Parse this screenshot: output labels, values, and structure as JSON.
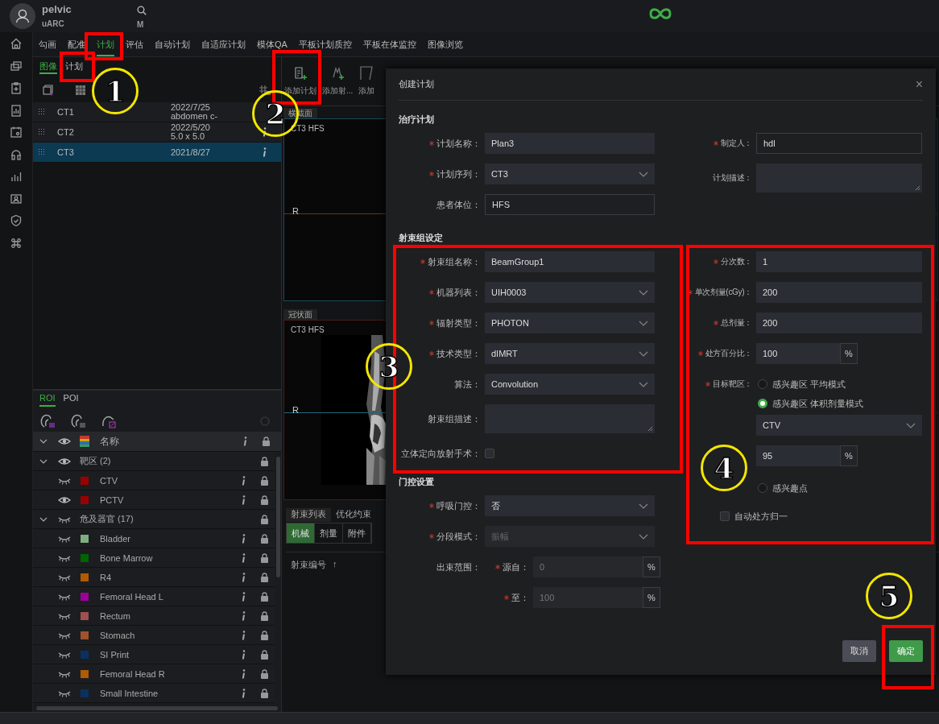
{
  "header": {
    "user": "pelvic",
    "subtitle": "uARC",
    "search_label": "M"
  },
  "nav_tabs": [
    {
      "label": "勾画",
      "selected": false
    },
    {
      "label": "配准",
      "selected": false
    },
    {
      "label": "计划",
      "selected": true
    },
    {
      "label": "评估",
      "selected": false
    },
    {
      "label": "自动计划",
      "selected": false
    },
    {
      "label": "自适应计划",
      "selected": false
    },
    {
      "label": "模体QA",
      "selected": false
    },
    {
      "label": "平板计划质控",
      "selected": false
    },
    {
      "label": "平板在体监控",
      "selected": false
    },
    {
      "label": "图像浏览",
      "selected": false
    }
  ],
  "left_panel": {
    "tabs": [
      {
        "label": "图像",
        "selected": true
      },
      {
        "label": "计划",
        "selected": false
      }
    ],
    "images": [
      {
        "name": "CT1",
        "date": "2022/7/25",
        "detail": "abdomen c-",
        "info": false,
        "selected": false
      },
      {
        "name": "CT2",
        "date": "2022/5/20",
        "detail": "5.0 x 5.0",
        "info": true,
        "selected": false
      },
      {
        "name": "CT3",
        "date": "2021/8/27",
        "info": true,
        "selected": true
      }
    ]
  },
  "roi_panel": {
    "tabs": [
      {
        "label": "ROI",
        "selected": true
      },
      {
        "label": "POI",
        "selected": false
      }
    ],
    "header": {
      "label": "名称",
      "visible": true,
      "expanded": true
    },
    "groups": [
      {
        "name": "靶区 (2)",
        "visible": true,
        "expanded": true,
        "children": [
          {
            "name": "CTV",
            "visible": false,
            "color": "#9b0000"
          },
          {
            "name": "PCTV",
            "visible": true,
            "color": "#9b0000"
          }
        ]
      },
      {
        "name": "危及器官 (17)",
        "visible": false,
        "expanded": true,
        "children": [
          {
            "name": "Bladder",
            "visible": false,
            "color": "#7fae7f"
          },
          {
            "name": "Bone Marrow",
            "visible": false,
            "color": "#006400"
          },
          {
            "name": "R4",
            "visible": false,
            "color": "#b05a00"
          },
          {
            "name": "Femoral Head L",
            "visible": false,
            "color": "#9b009b"
          },
          {
            "name": "Rectum",
            "visible": false,
            "color": "#a05050"
          },
          {
            "name": "Stomach",
            "visible": false,
            "color": "#a0522d"
          },
          {
            "name": "SI Print",
            "visible": false,
            "color": "#0a3060"
          },
          {
            "name": "Femoral Head R",
            "visible": false,
            "color": "#b05a01"
          },
          {
            "name": "Small Intestine",
            "visible": false,
            "color": "#0a3061"
          }
        ]
      }
    ]
  },
  "toolbar": [
    {
      "label": "添加计划"
    },
    {
      "label": "添加射..."
    },
    {
      "label": "添加"
    }
  ],
  "viewports": [
    {
      "title": "横截面",
      "caption": "CT3 HFS",
      "side": "R",
      "kind": "empty"
    },
    {
      "title": "冠状面",
      "caption": "CT3 HFS",
      "side": "R",
      "kind": "picture"
    }
  ],
  "beam_panel": {
    "tabs": [
      {
        "label": "射束列表",
        "selected": true
      },
      {
        "label": "优化约束",
        "selected": false
      }
    ],
    "modes": [
      {
        "label": "机械",
        "selected": true
      },
      {
        "label": "剂量",
        "selected": false
      },
      {
        "label": "附件",
        "selected": false
      }
    ],
    "column": "射束编号",
    "sort": "↑"
  },
  "dialog": {
    "title": "创建计划",
    "close": "×",
    "left": [
      {
        "title": "治疗计划",
        "fields": [
          {
            "kind": "input",
            "label": "计划名称：",
            "required": true,
            "value": "Plan3"
          },
          {
            "kind": "select",
            "label": "计划序列：",
            "required": true,
            "value": "CT3"
          },
          {
            "kind": "input",
            "label": "患者体位：",
            "required": false,
            "value": "HFS",
            "outlined": true
          }
        ]
      },
      {
        "title": "射束组设定",
        "fields": [
          {
            "kind": "input",
            "label": "射束组名称：",
            "required": true,
            "value": "BeamGroup1"
          },
          {
            "kind": "select",
            "label": "机器列表：",
            "required": true,
            "value": "UIH0003"
          },
          {
            "kind": "select",
            "label": "辐射类型：",
            "required": true,
            "value": "PHOTON"
          },
          {
            "kind": "select",
            "label": "技术类型：",
            "required": true,
            "value": "dIMRT"
          },
          {
            "kind": "select",
            "label": "算法：",
            "required": false,
            "value": "Convolution"
          },
          {
            "kind": "textarea",
            "label": "射束组描述：",
            "required": false
          },
          {
            "kind": "checkbox",
            "label": "立体定向放射手术：",
            "required": false,
            "checked": false
          }
        ]
      },
      {
        "title": "门控设置",
        "fields": [
          {
            "kind": "select",
            "label": "呼吸门控：",
            "required": true,
            "value": "否"
          },
          {
            "kind": "select",
            "label": "分段模式：",
            "required": true,
            "value": "振幅",
            "disabled": true
          },
          {
            "kind": "range",
            "label": "出束范围：",
            "sublabel": "源自：",
            "required": true,
            "value": "0",
            "unit": "%",
            "disabled": true
          },
          {
            "kind": "range",
            "sublabel": "至：",
            "required": true,
            "value": "100",
            "unit": "%",
            "disabled": true
          }
        ]
      }
    ],
    "right": [
      {
        "fields": [
          {
            "kind": "input",
            "label": "制定人：",
            "required": true,
            "value": "hdl",
            "outlined": true
          },
          {
            "kind": "textarea",
            "label": "计划描述：",
            "required": false
          }
        ]
      },
      {
        "fields": [
          {
            "kind": "input",
            "label": "分次数：",
            "required": true,
            "value": "1"
          },
          {
            "kind": "input",
            "label": "单次剂量(cGy)：",
            "required": true,
            "value": "200"
          },
          {
            "kind": "input",
            "label": "总剂量：",
            "required": true,
            "value": "200"
          },
          {
            "kind": "addon",
            "label": "处方百分比：",
            "required": true,
            "value": "100",
            "unit": "%"
          },
          {
            "kind": "radio-group",
            "label": "目标靶区：",
            "required": true,
            "options": [
              {
                "label": "感兴趣区 平均模式",
                "selected": false
              },
              {
                "label": "感兴趣区 体积剂量模式",
                "selected": true,
                "target": "CTV",
                "percent": "95",
                "unit": "%"
              },
              {
                "label": "感兴趣点",
                "selected": false
              }
            ]
          },
          {
            "kind": "check-option",
            "text": "自动处方归一",
            "checked": false
          }
        ]
      }
    ],
    "buttons": [
      {
        "label": "取消",
        "kind": "secondary"
      },
      {
        "label": "确定",
        "kind": "primary"
      }
    ]
  },
  "step_markers": [
    {
      "label": "1"
    },
    {
      "label": "2"
    },
    {
      "label": "3"
    },
    {
      "label": "4"
    },
    {
      "label": "5"
    }
  ]
}
